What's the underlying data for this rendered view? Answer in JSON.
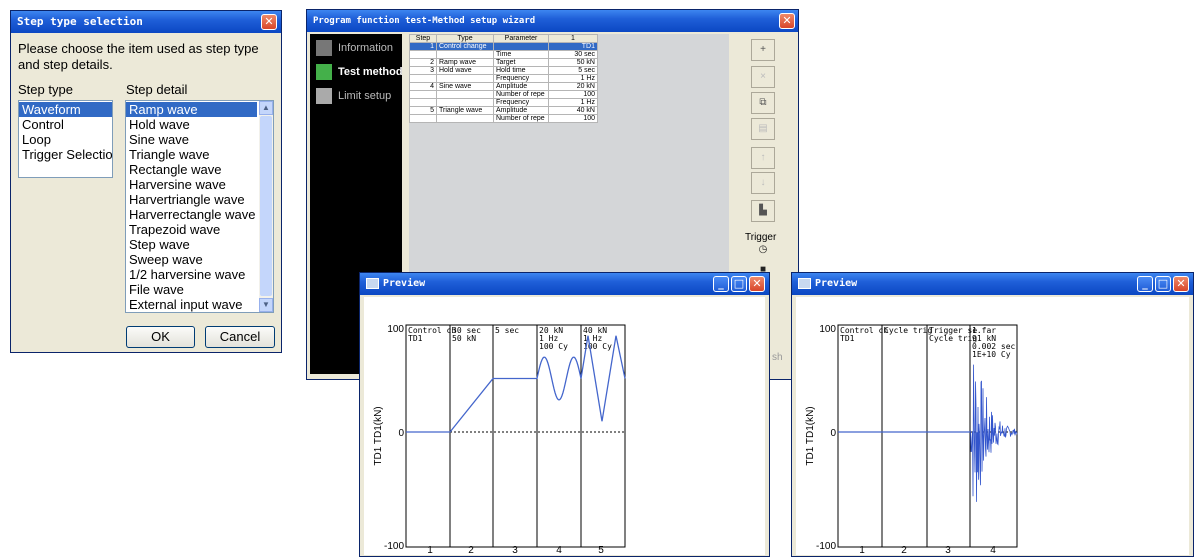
{
  "step_dialog": {
    "title": "Step type selection",
    "prompt_line1": "Please choose the item used as step type",
    "prompt_line2": "and step details.",
    "type_label": "Step type",
    "detail_label": "Step detail",
    "types": [
      "Waveform",
      "Control",
      "Loop",
      "Trigger Selection"
    ],
    "details": [
      "Ramp wave",
      "Hold wave",
      "Sine wave",
      "Triangle wave",
      "Rectangle wave",
      "Harversine wave",
      "Harvertriangle wave",
      "Harverrectangle wave",
      "Trapezoid wave",
      "Step wave",
      "Sweep wave",
      "1/2 harversine wave",
      "File wave",
      "External input wave"
    ],
    "ok_label": "OK",
    "cancel_label": "Cancel"
  },
  "wizard": {
    "title": "Program function test-Method setup wizard",
    "nav": [
      {
        "label": "Information",
        "color": "#777777"
      },
      {
        "label": "Test method",
        "color": "#44b04a"
      },
      {
        "label": "Limit setup",
        "color": "#aaaaaa"
      }
    ],
    "columns": [
      "Step",
      "Type",
      "Parameter",
      "1"
    ],
    "rows": [
      {
        "step": "1",
        "type": "Control change",
        "param": "",
        "value": "TD1",
        "selected": true
      },
      {
        "step": "",
        "type": "",
        "param": "Time",
        "value": "30 sec"
      },
      {
        "step": "2",
        "type": "Ramp wave",
        "param": "Target",
        "value": "50 kN"
      },
      {
        "step": "3",
        "type": "Hold wave",
        "param": "Hold time",
        "value": "5 sec"
      },
      {
        "step": "",
        "type": "",
        "param": "Frequency",
        "value": "1 Hz"
      },
      {
        "step": "4",
        "type": "Sine wave",
        "param": "Amplitude",
        "value": "20 kN"
      },
      {
        "step": "",
        "type": "",
        "param": "Number of repe",
        "value": "100"
      },
      {
        "step": "",
        "type": "",
        "param": "Frequency",
        "value": "1 Hz"
      },
      {
        "step": "5",
        "type": "Triangle wave",
        "param": "Amplitude",
        "value": "40 kN"
      },
      {
        "step": "",
        "type": "",
        "param": "Number of repe",
        "value": "100"
      }
    ],
    "trigger_label": "Trigger",
    "finish_fragment": "sh",
    "tools": [
      "add-icon",
      "delete-icon",
      "copy-icon",
      "paste-icon",
      "move-up-icon",
      "move-down-icon",
      "chart-icon",
      "timer-icon",
      "trigger-icon"
    ]
  },
  "preview1": {
    "title": "Preview",
    "ylabel": "TD1 TD1(kN)",
    "y_top": "100",
    "y_zero": "0",
    "y_bottom": "-100",
    "x_ticks": [
      "1",
      "2",
      "3",
      "4",
      "5"
    ],
    "segment_labels": [
      {
        "l1": "Control ch",
        "l2": "TD1",
        "l3": ""
      },
      {
        "l1": "30 sec",
        "l2": "50 kN",
        "l3": ""
      },
      {
        "l1": "5 sec",
        "l2": "",
        "l3": ""
      },
      {
        "l1": "20 kN",
        "l2": "1 Hz",
        "l3": "100 Cy"
      },
      {
        "l1": "40 kN",
        "l2": "1 Hz",
        "l3": "100 Cy"
      }
    ]
  },
  "preview2": {
    "title": "Preview",
    "ylabel": "TD1 TD1(kN)",
    "y_top": "100",
    "y_zero": "0",
    "y_bottom": "-100",
    "x_ticks": [
      "1",
      "2",
      "3",
      "4"
    ],
    "segment_labels": [
      {
        "l1": "Control ch",
        "l2": "TD1",
        "l3": "",
        "l4": ""
      },
      {
        "l1": "Cycle trig",
        "l2": "",
        "l3": "",
        "l4": ""
      },
      {
        "l1": "Trigger se",
        "l2": "Cycle trig",
        "l3": "",
        "l4": ""
      },
      {
        "l1": "1.far",
        "l2": "91 kN",
        "l3": "0.002 sec",
        "l4": "1E+10 Cy"
      }
    ]
  }
}
